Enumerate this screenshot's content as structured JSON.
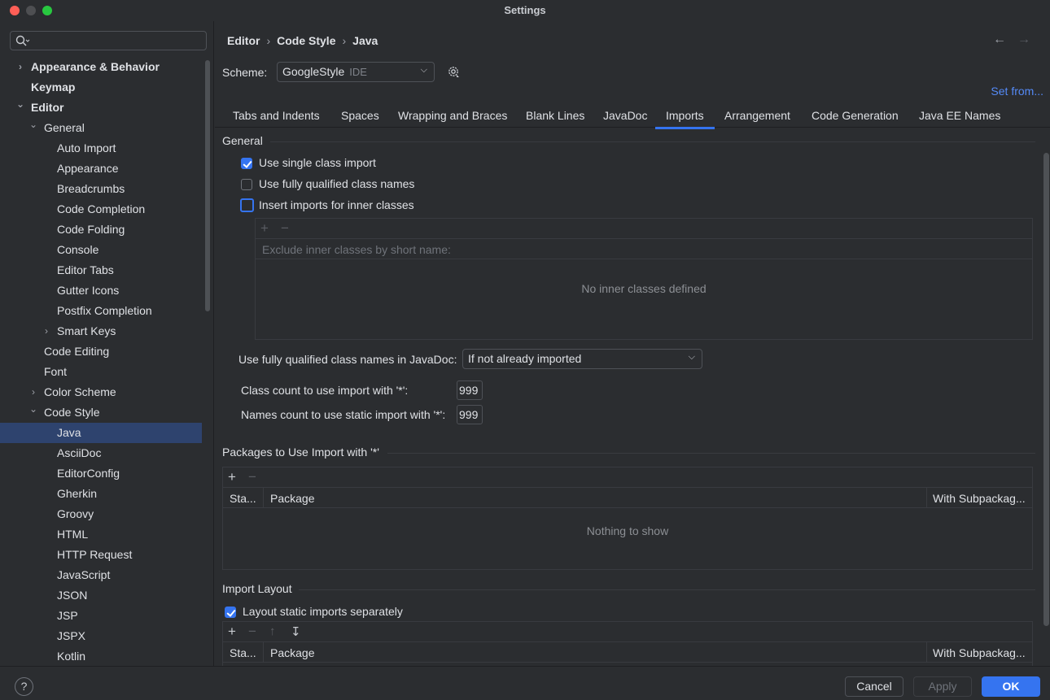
{
  "window": {
    "title": "Settings"
  },
  "sidebar": {
    "search": {
      "placeholder": ""
    },
    "items": [
      {
        "label": "Appearance & Behavior",
        "level": 0,
        "bold": true,
        "chevron": "right",
        "selected": false
      },
      {
        "label": "Keymap",
        "level": 0,
        "bold": true,
        "chevron": "",
        "selected": false
      },
      {
        "label": "Editor",
        "level": 0,
        "bold": true,
        "chevron": "down",
        "selected": false
      },
      {
        "label": "General",
        "level": 1,
        "bold": false,
        "chevron": "down",
        "selected": false
      },
      {
        "label": "Auto Import",
        "level": 2,
        "bold": false,
        "chevron": "",
        "selected": false
      },
      {
        "label": "Appearance",
        "level": 2,
        "bold": false,
        "chevron": "",
        "selected": false
      },
      {
        "label": "Breadcrumbs",
        "level": 2,
        "bold": false,
        "chevron": "",
        "selected": false
      },
      {
        "label": "Code Completion",
        "level": 2,
        "bold": false,
        "chevron": "",
        "selected": false
      },
      {
        "label": "Code Folding",
        "level": 2,
        "bold": false,
        "chevron": "",
        "selected": false
      },
      {
        "label": "Console",
        "level": 2,
        "bold": false,
        "chevron": "",
        "selected": false
      },
      {
        "label": "Editor Tabs",
        "level": 2,
        "bold": false,
        "chevron": "",
        "selected": false
      },
      {
        "label": "Gutter Icons",
        "level": 2,
        "bold": false,
        "chevron": "",
        "selected": false
      },
      {
        "label": "Postfix Completion",
        "level": 2,
        "bold": false,
        "chevron": "",
        "selected": false
      },
      {
        "label": "Smart Keys",
        "level": 2,
        "bold": false,
        "chevron": "right",
        "selected": false
      },
      {
        "label": "Code Editing",
        "level": 1,
        "bold": false,
        "chevron": "",
        "selected": false
      },
      {
        "label": "Font",
        "level": 1,
        "bold": false,
        "chevron": "",
        "selected": false
      },
      {
        "label": "Color Scheme",
        "level": 1,
        "bold": false,
        "chevron": "right",
        "selected": false
      },
      {
        "label": "Code Style",
        "level": 1,
        "bold": false,
        "chevron": "down",
        "selected": false
      },
      {
        "label": "Java",
        "level": 2,
        "bold": false,
        "chevron": "",
        "selected": true
      },
      {
        "label": "AsciiDoc",
        "level": 2,
        "bold": false,
        "chevron": "",
        "selected": false
      },
      {
        "label": "EditorConfig",
        "level": 2,
        "bold": false,
        "chevron": "",
        "selected": false
      },
      {
        "label": "Gherkin",
        "level": 2,
        "bold": false,
        "chevron": "",
        "selected": false
      },
      {
        "label": "Groovy",
        "level": 2,
        "bold": false,
        "chevron": "",
        "selected": false
      },
      {
        "label": "HTML",
        "level": 2,
        "bold": false,
        "chevron": "",
        "selected": false
      },
      {
        "label": "HTTP Request",
        "level": 2,
        "bold": false,
        "chevron": "",
        "selected": false
      },
      {
        "label": "JavaScript",
        "level": 2,
        "bold": false,
        "chevron": "",
        "selected": false
      },
      {
        "label": "JSON",
        "level": 2,
        "bold": false,
        "chevron": "",
        "selected": false
      },
      {
        "label": "JSP",
        "level": 2,
        "bold": false,
        "chevron": "",
        "selected": false
      },
      {
        "label": "JSPX",
        "level": 2,
        "bold": false,
        "chevron": "",
        "selected": false
      },
      {
        "label": "Kotlin",
        "level": 2,
        "bold": false,
        "chevron": "",
        "selected": false
      }
    ]
  },
  "breadcrumb": {
    "part1": "Editor",
    "part2": "Code Style",
    "part3": "Java",
    "separator": "›"
  },
  "nav": {
    "back": "←",
    "forward": "→"
  },
  "scheme": {
    "label": "Scheme:",
    "value": "GoogleStyle",
    "sub": "IDE",
    "set_from": "Set from..."
  },
  "tabs": [
    {
      "label": "Tabs and Indents",
      "active": false
    },
    {
      "label": "Spaces",
      "active": false
    },
    {
      "label": "Wrapping and Braces",
      "active": false
    },
    {
      "label": "Blank Lines",
      "active": false
    },
    {
      "label": "JavaDoc",
      "active": false
    },
    {
      "label": "Imports",
      "active": true
    },
    {
      "label": "Arrangement",
      "active": false
    },
    {
      "label": "Code Generation",
      "active": false
    },
    {
      "label": "Java EE Names",
      "active": false
    }
  ],
  "general": {
    "title": "General",
    "single_class_import": {
      "label": "Use single class import",
      "checked": true
    },
    "fully_qualified": {
      "label": "Use fully qualified class names",
      "checked": false
    },
    "inner_classes": {
      "label": "Insert imports for inner classes",
      "checked": false
    },
    "exclude_placeholder": "Exclude inner classes by short name:",
    "inner_empty": "No inner classes defined",
    "javadoc_label": "Use fully qualified class names in JavaDoc:",
    "javadoc_value": "If not already imported",
    "class_count_label": "Class count to use import with '*':",
    "class_count_value": "999",
    "names_count_label": "Names count to use static import with '*':",
    "names_count_value": "999"
  },
  "packages": {
    "title": "Packages to Use Import with '*'",
    "col_static": "Sta...",
    "col_package": "Package",
    "col_sub": "With Subpackag...",
    "empty": "Nothing to show"
  },
  "import_layout": {
    "title": "Import Layout",
    "static_separately": {
      "label": "Layout static imports separately",
      "checked": true
    },
    "col_static": "Sta...",
    "col_package": "Package",
    "col_sub": "With Subpackag..."
  },
  "footer": {
    "help": "?",
    "cancel": "Cancel",
    "apply": "Apply",
    "ok": "OK"
  },
  "colors": {
    "accent": "#3574f0",
    "link": "#548af7",
    "selection": "#2e436e",
    "background": "#2b2d30"
  }
}
